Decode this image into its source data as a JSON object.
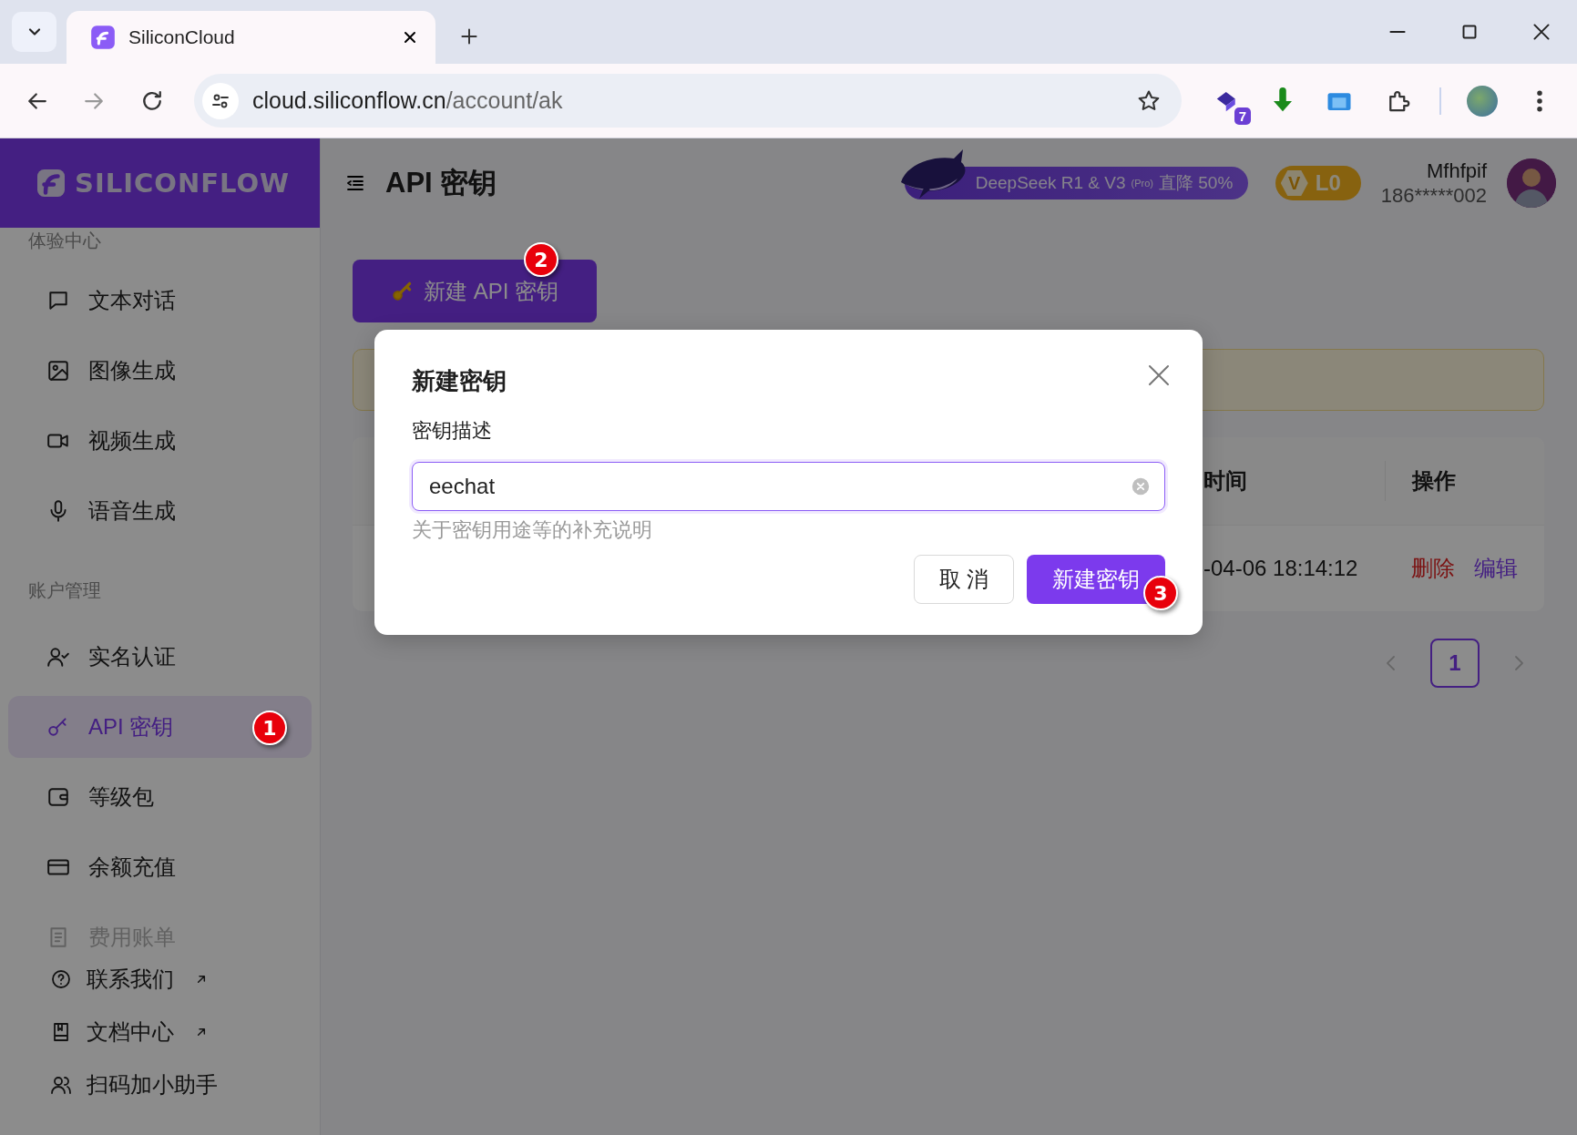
{
  "browser": {
    "tab_title": "SiliconCloud",
    "url_host": "cloud.siliconflow.cn",
    "url_path": "/account/ak",
    "extension_badge": "7"
  },
  "sidebar": {
    "logo": "SILICONFLOW",
    "sections": [
      {
        "title": "体验中心",
        "items": [
          {
            "label": "文本对话",
            "selected": false
          },
          {
            "label": "图像生成",
            "selected": false
          },
          {
            "label": "视频生成",
            "selected": false
          },
          {
            "label": "语音生成",
            "selected": false
          }
        ]
      },
      {
        "title": "账户管理",
        "items": [
          {
            "label": "实名认证",
            "selected": false
          },
          {
            "label": "API 密钥",
            "selected": true,
            "annotation": "1"
          },
          {
            "label": "等级包",
            "selected": false
          },
          {
            "label": "余额充值",
            "selected": false
          },
          {
            "label": "费用账单",
            "selected": false
          }
        ]
      }
    ],
    "footer_links": [
      {
        "label": "联系我们",
        "external": true
      },
      {
        "label": "文档中心",
        "external": true
      },
      {
        "label": "扫码加小助手",
        "external": false
      }
    ]
  },
  "header": {
    "title": "API 密钥",
    "promo": {
      "text": "DeepSeek R1 & V3",
      "tag": "(Pro)",
      "offer": "直降 50%"
    },
    "level_badge": {
      "letter": "V",
      "label": "L0"
    },
    "user": {
      "name": "Mfhfpif",
      "phone": "186*****002"
    }
  },
  "content": {
    "new_key_button": {
      "label": "新建 API 密钥",
      "annotation": "2"
    },
    "table": {
      "columns": [
        "时间",
        "操作"
      ],
      "rows": [
        {
          "time": "-04-06 18:14:12",
          "actions": [
            {
              "label": "删除",
              "kind": "danger"
            },
            {
              "label": "编辑",
              "kind": "primary"
            }
          ]
        }
      ]
    },
    "pagination": {
      "pages": [
        {
          "label": "1",
          "selected": true
        }
      ]
    }
  },
  "dialog": {
    "title": "新建密钥",
    "field_label": "密钥描述",
    "value": "eechat",
    "help": "关于密钥用途等的补充说明",
    "buttons": [
      {
        "label": "取 消",
        "kind": "default"
      },
      {
        "label": "新建密钥",
        "kind": "primary",
        "annotation": "3"
      }
    ]
  }
}
